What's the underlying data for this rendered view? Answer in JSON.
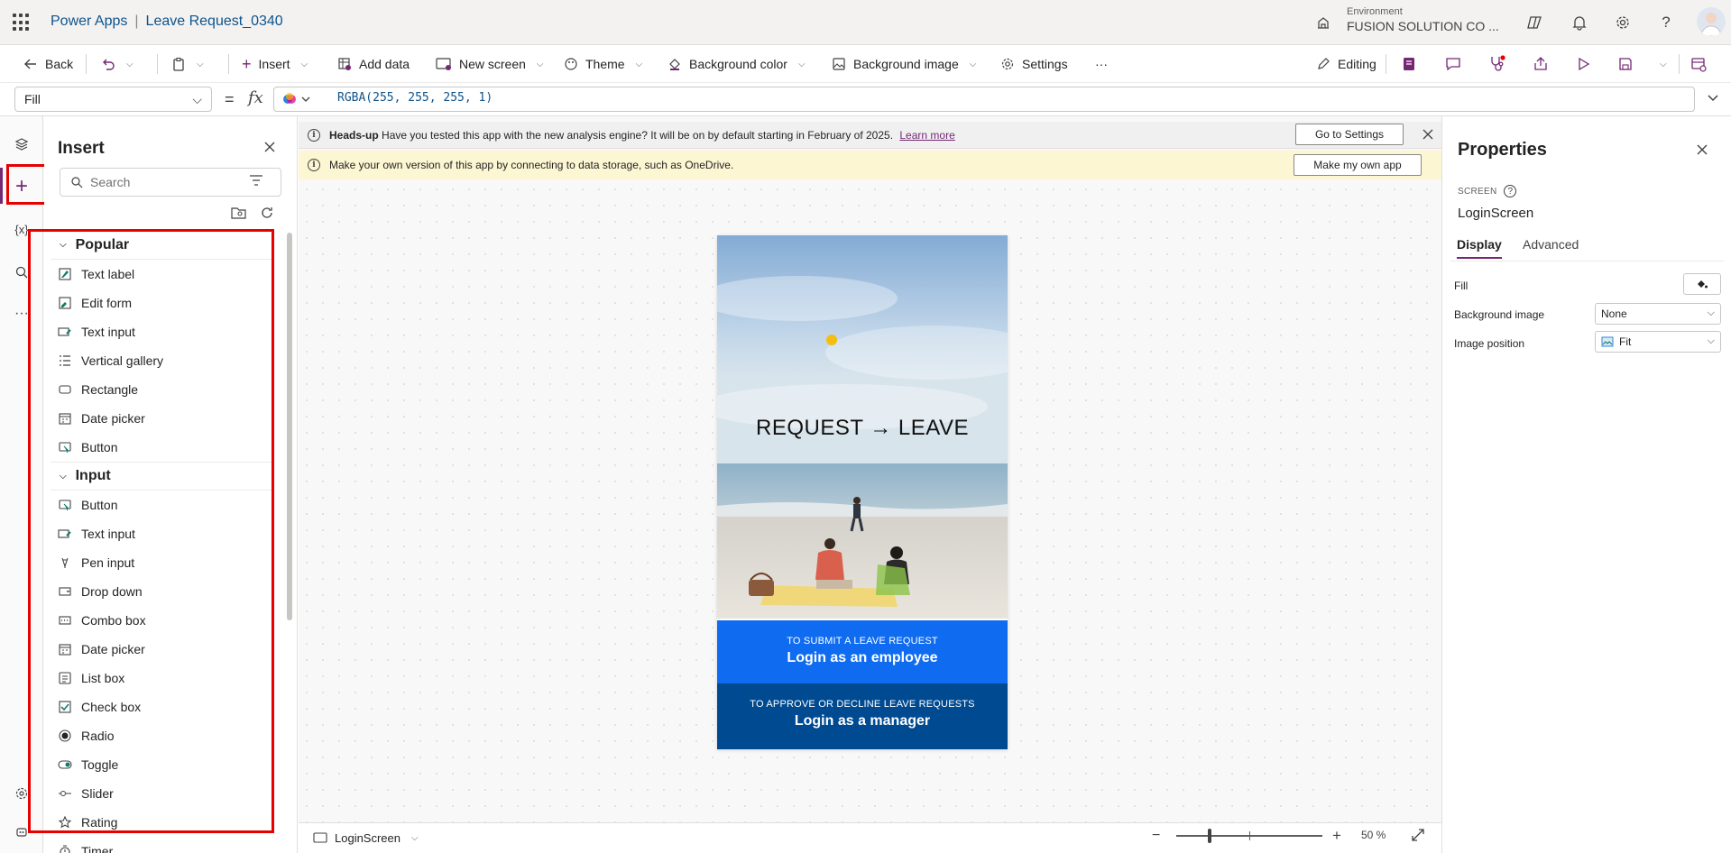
{
  "header": {
    "product": "Power Apps",
    "app_name": "Leave Request_0340",
    "environment_label": "Environment",
    "environment_name": "FUSION SOLUTION CO ..."
  },
  "commandbar": {
    "back": "Back",
    "insert": "Insert",
    "add_data": "Add data",
    "new_screen": "New screen",
    "theme": "Theme",
    "background_color": "Background color",
    "background_image": "Background image",
    "settings": "Settings",
    "more": "···",
    "editing": "Editing"
  },
  "formula": {
    "property": "Fill",
    "eq": "=",
    "fx": "fx",
    "expression": "RGBA(255, 255, 255, 1)"
  },
  "insert_pane": {
    "title": "Insert",
    "search_placeholder": "Search",
    "sections": [
      {
        "title": "Popular",
        "items": [
          "Text label",
          "Edit form",
          "Text input",
          "Vertical gallery",
          "Rectangle",
          "Date picker",
          "Button"
        ]
      },
      {
        "title": "Input",
        "items": [
          "Button",
          "Text input",
          "Pen input",
          "Drop down",
          "Combo box",
          "Date picker",
          "List box",
          "Check box",
          "Radio",
          "Toggle",
          "Slider",
          "Rating",
          "Timer"
        ]
      }
    ]
  },
  "banners": {
    "headsup_bold": "Heads-up",
    "headsup_text": "Have you tested this app with the new analysis engine? It will be on by default starting in February of 2025.",
    "learn_more": "Learn more",
    "go_to_settings": "Go to Settings",
    "storage_text": "Make your own version of this app by connecting to data storage, such as OneDrive.",
    "make_my_own": "Make my own app"
  },
  "app_screen": {
    "heading": "REQUEST → LEAVE",
    "employee_small": "TO SUBMIT A LEAVE REQUEST",
    "employee_big": "Login as an employee",
    "manager_small": "TO APPROVE OR DECLINE LEAVE REQUESTS",
    "manager_big": "Login as a manager"
  },
  "canvas_footer": {
    "screen": "LoginScreen",
    "zoom": "50  %",
    "zoom_fraction": 0.23
  },
  "properties": {
    "title": "Properties",
    "kind": "SCREEN",
    "name": "LoginScreen",
    "tabs": [
      "Display",
      "Advanced"
    ],
    "fill_label": "Fill",
    "bg_image_label": "Background image",
    "bg_image_value": "None",
    "image_position_label": "Image position",
    "image_position_value": "Fit"
  },
  "colors": {
    "accent": "#742774",
    "employee_button": "#0f6cf1",
    "manager_button": "#004a91",
    "highlight": "#e60000"
  }
}
